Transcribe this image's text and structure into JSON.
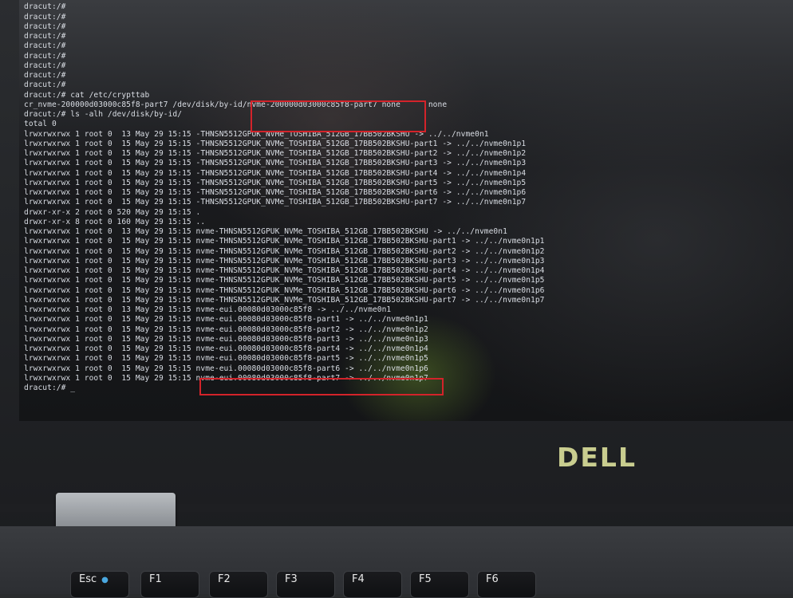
{
  "terminal": {
    "lines": [
      "dracut:/#",
      "dracut:/#",
      "dracut:/#",
      "dracut:/#",
      "dracut:/#",
      "dracut:/#",
      "dracut:/#",
      "dracut:/#",
      "dracut:/#",
      "dracut:/#",
      "dracut:/# cat /etc/crypttab",
      "cr_nvme-200000d03000c85f8-part7 /dev/disk/by-id/nvme-200000d03000c85f8-part7 none      none",
      "dracut:/# ls -alh /dev/disk/by-id/",
      "total 0",
      "lrwxrwxrwx 1 root 0  13 May 29 15:15 -THNSN5512GPUK_NVMe_TOSHIBA_512GB_17BB502BKSHU -> ../../nvme0n1",
      "lrwxrwxrwx 1 root 0  15 May 29 15:15 -THNSN5512GPUK_NVMe_TOSHIBA_512GB_17BB502BKSHU-part1 -> ../../nvme0n1p1",
      "lrwxrwxrwx 1 root 0  15 May 29 15:15 -THNSN5512GPUK_NVMe_TOSHIBA_512GB_17BB502BKSHU-part2 -> ../../nvme0n1p2",
      "lrwxrwxrwx 1 root 0  15 May 29 15:15 -THNSN5512GPUK_NVMe_TOSHIBA_512GB_17BB502BKSHU-part3 -> ../../nvme0n1p3",
      "lrwxrwxrwx 1 root 0  15 May 29 15:15 -THNSN5512GPUK_NVMe_TOSHIBA_512GB_17BB502BKSHU-part4 -> ../../nvme0n1p4",
      "lrwxrwxrwx 1 root 0  15 May 29 15:15 -THNSN5512GPUK_NVMe_TOSHIBA_512GB_17BB502BKSHU-part5 -> ../../nvme0n1p5",
      "lrwxrwxrwx 1 root 0  15 May 29 15:15 -THNSN5512GPUK_NVMe_TOSHIBA_512GB_17BB502BKSHU-part6 -> ../../nvme0n1p6",
      "lrwxrwxrwx 1 root 0  15 May 29 15:15 -THNSN5512GPUK_NVMe_TOSHIBA_512GB_17BB502BKSHU-part7 -> ../../nvme0n1p7",
      "drwxr-xr-x 2 root 0 520 May 29 15:15 .",
      "drwxr-xr-x 8 root 0 160 May 29 15:15 ..",
      "lrwxrwxrwx 1 root 0  13 May 29 15:15 nvme-THNSN5512GPUK_NVMe_TOSHIBA_512GB_17BB502BKSHU -> ../../nvme0n1",
      "lrwxrwxrwx 1 root 0  15 May 29 15:15 nvme-THNSN5512GPUK_NVMe_TOSHIBA_512GB_17BB502BKSHU-part1 -> ../../nvme0n1p1",
      "lrwxrwxrwx 1 root 0  15 May 29 15:15 nvme-THNSN5512GPUK_NVMe_TOSHIBA_512GB_17BB502BKSHU-part2 -> ../../nvme0n1p2",
      "lrwxrwxrwx 1 root 0  15 May 29 15:15 nvme-THNSN5512GPUK_NVMe_TOSHIBA_512GB_17BB502BKSHU-part3 -> ../../nvme0n1p3",
      "lrwxrwxrwx 1 root 0  15 May 29 15:15 nvme-THNSN5512GPUK_NVMe_TOSHIBA_512GB_17BB502BKSHU-part4 -> ../../nvme0n1p4",
      "lrwxrwxrwx 1 root 0  15 May 29 15:15 nvme-THNSN5512GPUK_NVMe_TOSHIBA_512GB_17BB502BKSHU-part5 -> ../../nvme0n1p5",
      "lrwxrwxrwx 1 root 0  15 May 29 15:15 nvme-THNSN5512GPUK_NVMe_TOSHIBA_512GB_17BB502BKSHU-part6 -> ../../nvme0n1p6",
      "lrwxrwxrwx 1 root 0  15 May 29 15:15 nvme-THNSN5512GPUK_NVMe_TOSHIBA_512GB_17BB502BKSHU-part7 -> ../../nvme0n1p7",
      "lrwxrwxrwx 1 root 0  13 May 29 15:15 nvme-eui.00080d03000c85f8 -> ../../nvme0n1",
      "lrwxrwxrwx 1 root 0  15 May 29 15:15 nvme-eui.00080d03000c85f8-part1 -> ../../nvme0n1p1",
      "lrwxrwxrwx 1 root 0  15 May 29 15:15 nvme-eui.00080d03000c85f8-part2 -> ../../nvme0n1p2",
      "lrwxrwxrwx 1 root 0  15 May 29 15:15 nvme-eui.00080d03000c85f8-part3 -> ../../nvme0n1p3",
      "lrwxrwxrwx 1 root 0  15 May 29 15:15 nvme-eui.00080d03000c85f8-part4 -> ../../nvme0n1p4",
      "lrwxrwxrwx 1 root 0  15 May 29 15:15 nvme-eui.00080d03000c85f8-part5 -> ../../nvme0n1p5",
      "lrwxrwxrwx 1 root 0  15 May 29 15:15 nvme-eui.00080d03000c85f8-part6 -> ../../nvme0n1p6",
      "lrwxrwxrwx 1 root 0  15 May 29 15:15 nvme-eui.00080d03000c85f8-part7 -> ../../nvme0n1p7",
      "dracut:/# _"
    ]
  },
  "highlight_color": "#d3232a",
  "brand": {
    "logo_text": "DELL",
    "color": "#c9cd8f"
  },
  "keyboard": {
    "keys": [
      "Esc",
      "F1",
      "F2",
      "F3",
      "F4",
      "F5",
      "F6"
    ]
  }
}
